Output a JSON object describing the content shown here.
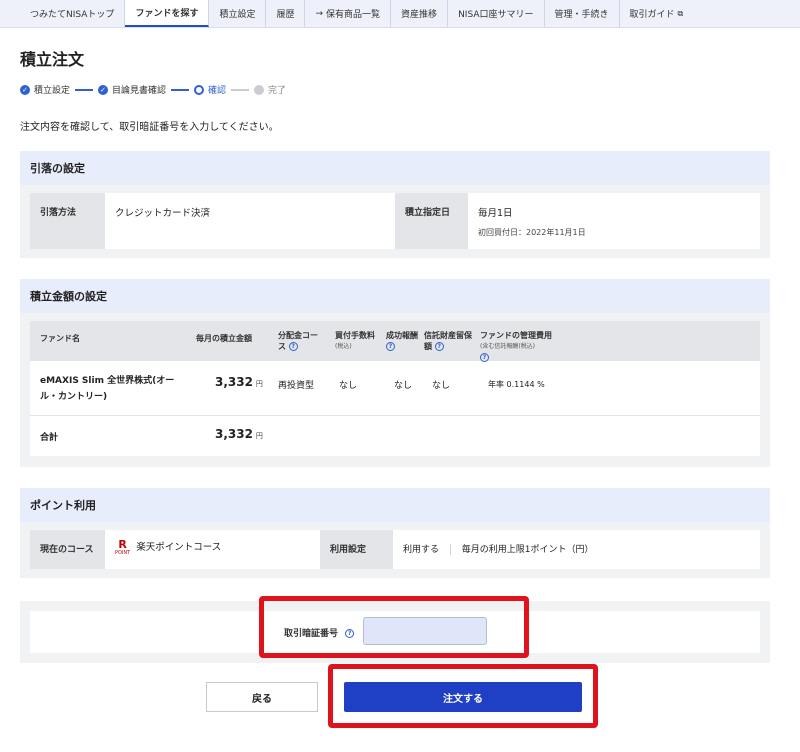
{
  "nav": {
    "items": [
      {
        "label": "つみたてNISAトップ",
        "prefix": "",
        "suffix": "",
        "active": false
      },
      {
        "label": "ファンドを探す",
        "prefix": "",
        "suffix": "",
        "active": true
      },
      {
        "label": "積立設定",
        "prefix": "",
        "suffix": "",
        "active": false
      },
      {
        "label": "履歴",
        "prefix": "",
        "suffix": "",
        "active": false
      },
      {
        "label": "保有商品一覧",
        "prefix": "→",
        "suffix": "",
        "active": false
      },
      {
        "label": "資産推移",
        "prefix": "",
        "suffix": "",
        "active": false
      },
      {
        "label": "NISA口座サマリー",
        "prefix": "",
        "suffix": "",
        "active": false
      },
      {
        "label": "管理・手続き",
        "prefix": "",
        "suffix": "",
        "active": false
      },
      {
        "label": "取引ガイド",
        "prefix": "",
        "suffix": "⧉",
        "active": false
      }
    ]
  },
  "page": {
    "title": "積立注文",
    "instruction": "注文内容を確認して、取引暗証番号を入力してください。"
  },
  "steps": [
    {
      "label": "積立設定",
      "state": "done"
    },
    {
      "label": "目論見書確認",
      "state": "done"
    },
    {
      "label": "確認",
      "state": "current"
    },
    {
      "label": "完了",
      "state": "todo"
    }
  ],
  "withdrawal": {
    "heading": "引落の設定",
    "method_label": "引落方法",
    "method_value": "クレジットカード決済",
    "date_label": "積立指定日",
    "date_value": "毎月1日",
    "first_purchase": "初回買付日：2022年11月1日"
  },
  "amount": {
    "heading": "積立金額の設定",
    "columns": {
      "fund": "ファンド名",
      "monthly": "毎月の積立金額",
      "dist": "分配金コース",
      "buy_fee": "買付手数料",
      "buy_fee_sub": "(税込)",
      "success_fee": "成功報酬",
      "reserve": "信託財産留保額",
      "mgmt": "ファンドの管理費用",
      "mgmt_sub": "(含む信託報酬(税込)"
    },
    "fund": {
      "name": "eMAXIS Slim 全世界株式(オール・カントリー)",
      "monthly": "3,332",
      "unit": "円",
      "dist": "再投資型",
      "buy_fee": "なし",
      "success_fee": "なし",
      "reserve": "なし",
      "mgmt": "年率 0.1144 %"
    },
    "total_label": "合計",
    "total_value": "3,332",
    "total_unit": "円"
  },
  "point": {
    "heading": "ポイント利用",
    "course_label": "現在のコース",
    "logo_r": "R",
    "logo_text": "POINT",
    "course_value": "楽天ポイントコース",
    "usage_label": "利用設定",
    "usage_value": "利用する",
    "usage_detail": "毎月の利用上限1ポイント（円）"
  },
  "pin": {
    "label": "取引暗証番号"
  },
  "buttons": {
    "back": "戻る",
    "order": "注文する"
  },
  "colors": {
    "accent": "#1f3fc4",
    "highlight": "#e0121b",
    "section_head": "#e8edfb"
  }
}
